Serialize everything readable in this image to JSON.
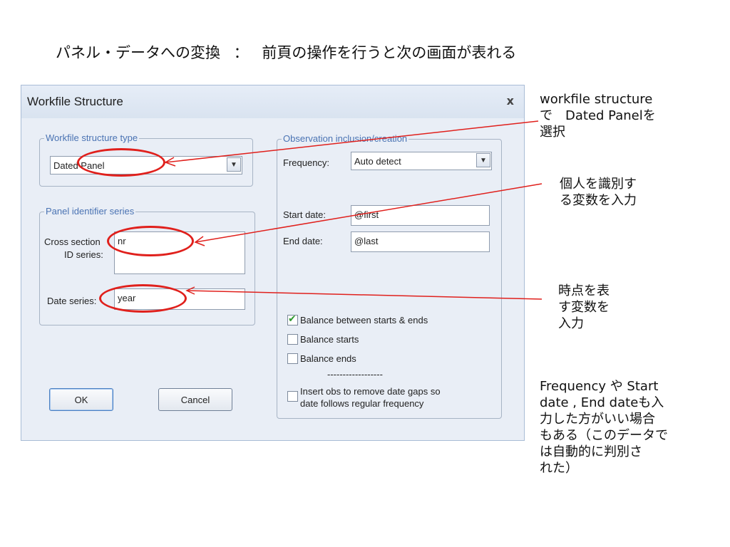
{
  "slide": {
    "title_left": "パネル・データへの変換",
    "title_sep": "：",
    "title_right": "前頁の操作を行うと次の画面が表れる"
  },
  "dialog": {
    "title": "Workfile Structure",
    "close_label": "x",
    "structure_group": {
      "label": "Workfile structure type",
      "selected": "Dated Panel"
    },
    "panel_group": {
      "label": "Panel identifier series",
      "cross_section_label_1": "Cross section",
      "cross_section_label_2": "ID series:",
      "cross_section_value": "nr",
      "date_series_label": "Date series:",
      "date_series_value": "year"
    },
    "observation_group": {
      "label": "Observation inclusion/creation",
      "frequency_label": "Frequency:",
      "frequency_value": "Auto detect",
      "start_date_label": "Start date:",
      "start_date_value": "@first",
      "end_date_label": "End date:",
      "end_date_value": "@last",
      "checks": [
        {
          "label": "Balance between starts & ends",
          "checked": true
        },
        {
          "label": "Balance starts",
          "checked": false
        },
        {
          "label": "Balance ends",
          "checked": false
        }
      ],
      "separator": "------------------",
      "insert_label_1": "Insert obs to remove date gaps so",
      "insert_label_2": "date follows regular frequency",
      "insert_checked": false
    },
    "ok_label": "OK",
    "cancel_label": "Cancel"
  },
  "annotations": {
    "note1": [
      "workfile structure",
      "で　Dated Panelを",
      "選択"
    ],
    "note2": [
      "個人を識別す",
      "る変数を入力"
    ],
    "note3": [
      "時点を表",
      "す変数を",
      "入力"
    ],
    "note4": [
      "Frequency や Start",
      "date , End dateも入",
      "力した方がいい場合",
      "もある（このデータで",
      "は自動的に判別さ",
      "れた）"
    ],
    "accent_color": "#e0201c"
  }
}
